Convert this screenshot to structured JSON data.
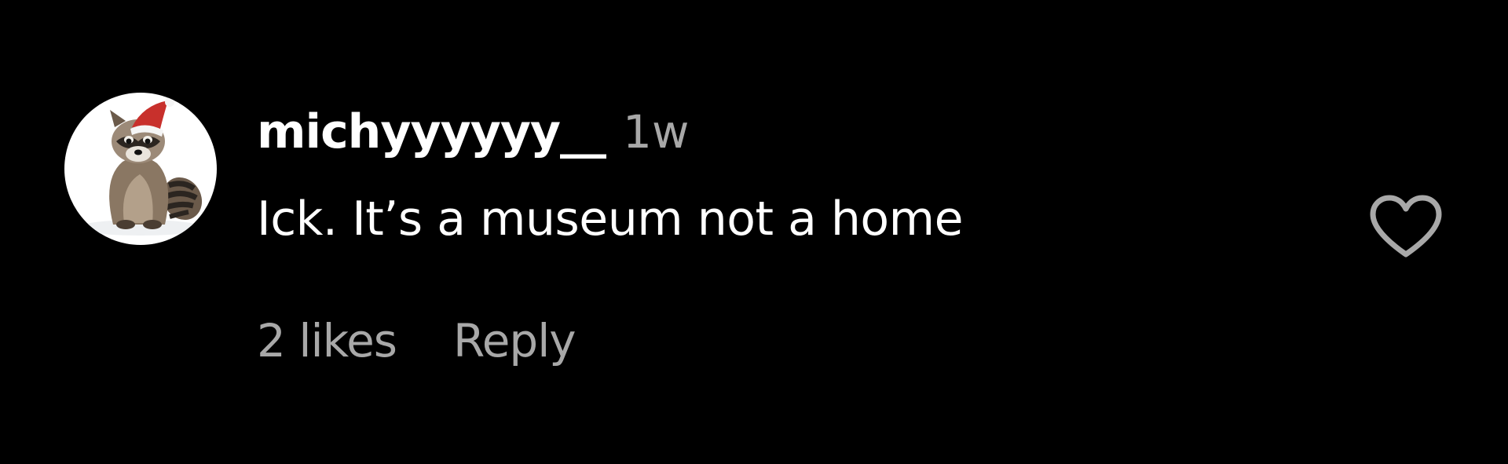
{
  "comment": {
    "username": "michyyyyyy__",
    "timestamp": "1w",
    "text": "Ick. It’s a museum not a home",
    "likes_label": "2 likes",
    "reply_label": "Reply",
    "avatar_icon": "raccoon-santa-hat-avatar",
    "like_icon": "heart-outline-icon"
  },
  "colors": {
    "background": "#000000",
    "primary_text": "#ffffff",
    "secondary_text": "#a8a8a8"
  }
}
